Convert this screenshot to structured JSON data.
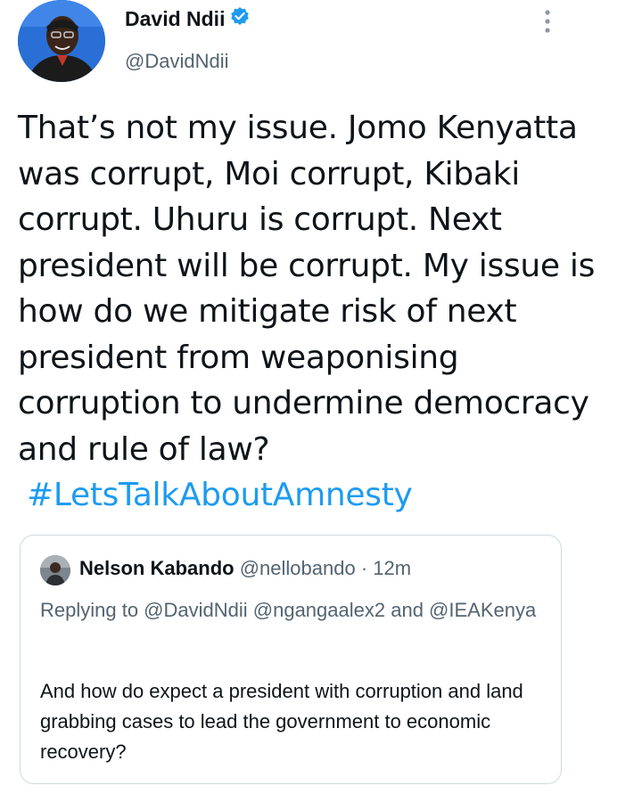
{
  "author": {
    "display_name": "David Ndii",
    "handle": "@DavidNdii",
    "verified": true,
    "avatar_icon": "user-avatar"
  },
  "tweet": {
    "text": "That’s not my issue. Jomo Kenyatta was corrupt, Moi corrupt, Kibaki corrupt. Uhuru is corrupt. Next president will be corrupt. My issue is how do we mitigate risk of next president from weaponising corruption to undermine democracy and rule of law?",
    "hashtag": "#LetsTalkAboutAmnesty"
  },
  "quoted_tweet": {
    "display_name": "Nelson Kabando",
    "handle": "@nellobando",
    "separator": "·",
    "time": "12m",
    "replying_to": "Replying to @DavidNdii @ngangaalex2 and @IEAKenya",
    "text": "And how do expect a president with corruption and land grabbing cases to lead the government to economic recovery?"
  },
  "colors": {
    "link": "#1d9bf0",
    "secondary_text": "#536471",
    "primary_text": "#0f1419",
    "border": "#cfd9de",
    "verified_badge": "#1d9bf0"
  }
}
